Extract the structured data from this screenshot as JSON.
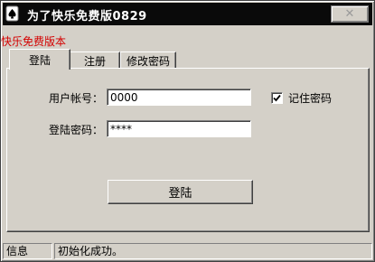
{
  "window": {
    "title": "为了快乐免费版0829",
    "close_symbol": "✕",
    "app_icon": "playing-card-spade-icon"
  },
  "free_label": "快乐免费版本",
  "tabs": [
    {
      "label": "登陆",
      "active": true
    },
    {
      "label": "注册",
      "active": false
    },
    {
      "label": "修改密码",
      "active": false
    }
  ],
  "login": {
    "account_label": "用户帐号：",
    "account_value": "0000",
    "password_label": "登陆密码：",
    "password_value": "****",
    "remember_label": "记住密码",
    "remember_checked": true,
    "login_button": "登陆"
  },
  "status": {
    "pane1": "信息",
    "pane2": "初始化成功。"
  },
  "colors": {
    "titlebar": "#0a0a0a",
    "face": "#d4d0c8",
    "free_label": "#d40000"
  }
}
